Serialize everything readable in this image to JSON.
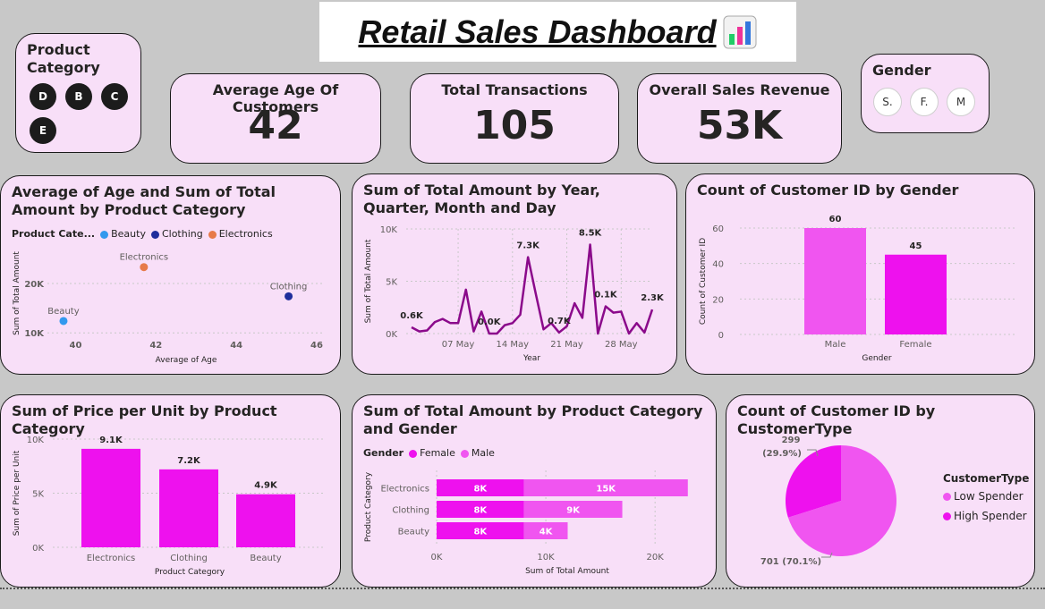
{
  "title": "Retail Sales Dashboard",
  "product_slicer": {
    "title": "Product Category",
    "items": [
      "D",
      "B",
      "C",
      "E"
    ]
  },
  "gender_slicer": {
    "title": "Gender",
    "items": [
      "S.",
      "F.",
      "M"
    ]
  },
  "kpis": [
    {
      "label": "Average Age Of Customers",
      "value": "42"
    },
    {
      "label": "Total Transactions",
      "value": "105"
    },
    {
      "label": "Overall Sales Revenue",
      "value": "53K"
    }
  ],
  "colors": {
    "magenta": "#ee11ee",
    "pink": "#f055f0",
    "purple": "#8b0a8b",
    "beauty": "#3399ee",
    "clothing": "#1f2e9c",
    "electronics": "#e77a49"
  },
  "chart_data": [
    {
      "id": "scatter",
      "type": "scatter",
      "title": "Average of Age and Sum of Total Amount by Product Category",
      "xlabel": "Average of Age",
      "ylabel": "Sum of Total Amount",
      "legend_title": "Product Cate...",
      "xlim": [
        39.3,
        46.2
      ],
      "ylim": [
        9500,
        26500
      ],
      "xticks": [
        "40",
        "42",
        "44",
        "46"
      ],
      "yticks": [
        "10K",
        "20K"
      ],
      "points": [
        {
          "name": "Beauty",
          "x": 39.7,
          "y": 12400,
          "color": "#3399ee"
        },
        {
          "name": "Clothing",
          "x": 45.3,
          "y": 17400,
          "color": "#1f2e9c"
        },
        {
          "name": "Electronics",
          "x": 41.7,
          "y": 23300,
          "color": "#e77a49"
        }
      ]
    },
    {
      "id": "line",
      "type": "line",
      "title": "Sum of Total Amount by Year, Quarter, Month and Day",
      "xlabel": "Year",
      "ylabel": "Sum of Total Amount",
      "ylim": [
        0,
        10000
      ],
      "yticks": [
        "0K",
        "5K",
        "10K"
      ],
      "xticks": [
        "07 May",
        "14 May",
        "21 May",
        "28 May"
      ],
      "values": [
        600,
        200,
        300,
        1100,
        1400,
        1000,
        1000,
        4200,
        200,
        2100,
        0,
        0,
        800,
        1000,
        1800,
        7300,
        3800,
        400,
        1000,
        100,
        700,
        2900,
        1500,
        8500,
        0,
        2600,
        2000,
        2100,
        0,
        1000,
        100,
        2300
      ],
      "labels": [
        "0.6K",
        "0.0K",
        "7.3K",
        "0.7K",
        "8.5K",
        "0.1K",
        "2.3K"
      ]
    },
    {
      "id": "gender_bar",
      "type": "bar",
      "title": "Count of Customer ID by Gender",
      "xlabel": "Gender",
      "ylabel": "Count of Customer ID",
      "categories": [
        "Male",
        "Female"
      ],
      "values": [
        60,
        45
      ],
      "ylim": [
        0,
        60
      ],
      "yticks": [
        "0",
        "20",
        "40",
        "60"
      ]
    },
    {
      "id": "price_bar",
      "type": "bar",
      "title": "Sum of Price per Unit by Product Category",
      "xlabel": "Product Category",
      "ylabel": "Sum of Price per Unit",
      "categories": [
        "Electronics",
        "Clothing",
        "Beauty"
      ],
      "values": [
        9100,
        7200,
        4900
      ],
      "labels": [
        "9.1K",
        "7.2K",
        "4.9K"
      ],
      "ylim": [
        0,
        10000
      ],
      "yticks": [
        "0K",
        "5K",
        "10K"
      ]
    },
    {
      "id": "stacked_bar",
      "type": "bar",
      "title": "Sum of Total Amount by Product Category and Gender",
      "xlabel": "Sum of Total Amount",
      "ylabel": "Product Category",
      "legend_title": "Gender",
      "categories": [
        "Electronics",
        "Clothing",
        "Beauty"
      ],
      "series": [
        {
          "name": "Female",
          "values": [
            8000,
            8000,
            8000
          ],
          "labels": [
            "8K",
            "8K",
            "8K"
          ]
        },
        {
          "name": "Male",
          "values": [
            15000,
            9000,
            4000
          ],
          "labels": [
            "15K",
            "9K",
            "4K"
          ]
        }
      ],
      "xlim": [
        0,
        24000
      ],
      "xticks": [
        "0K",
        "10K",
        "20K"
      ]
    },
    {
      "id": "pie",
      "type": "pie",
      "title": "Count of Customer ID by CustomerType",
      "legend_title": "CustomerType",
      "slices": [
        {
          "name": "Low Spender",
          "value": 701,
          "label": "701 (70.1%)"
        },
        {
          "name": "High Spender",
          "value": 299,
          "label": "299",
          "label2": "(29.9%)"
        }
      ]
    }
  ]
}
